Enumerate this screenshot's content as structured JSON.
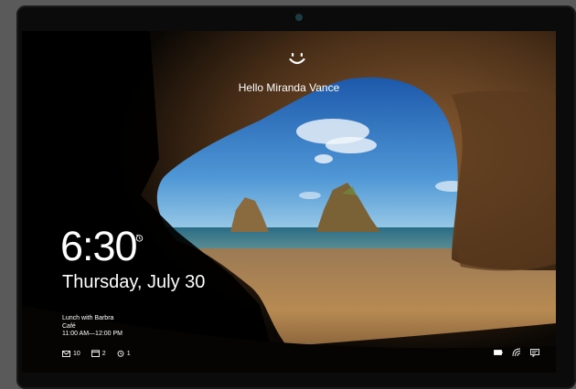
{
  "lock_screen": {
    "greeting": "Hello Miranda Vance",
    "time": "6:30",
    "date": "Thursday, July 30",
    "event": {
      "title": "Lunch with Barbra",
      "location": "Café",
      "time": "11:00 AM—12:00 PM"
    },
    "badges": [
      {
        "icon": "mail-icon",
        "count": "10"
      },
      {
        "icon": "calendar-icon",
        "count": "2"
      },
      {
        "icon": "alarm-icon",
        "count": "1"
      }
    ],
    "system_icons": [
      "battery-icon",
      "wifi-icon",
      "notification-icon"
    ]
  },
  "colors": {
    "sky_top": "#1f5fb0",
    "sky_bottom": "#8fc4e6",
    "sea": "#2f6f8a",
    "sand": "#b88a52",
    "rock": "#6e4a2a",
    "text": "#ffffff"
  }
}
